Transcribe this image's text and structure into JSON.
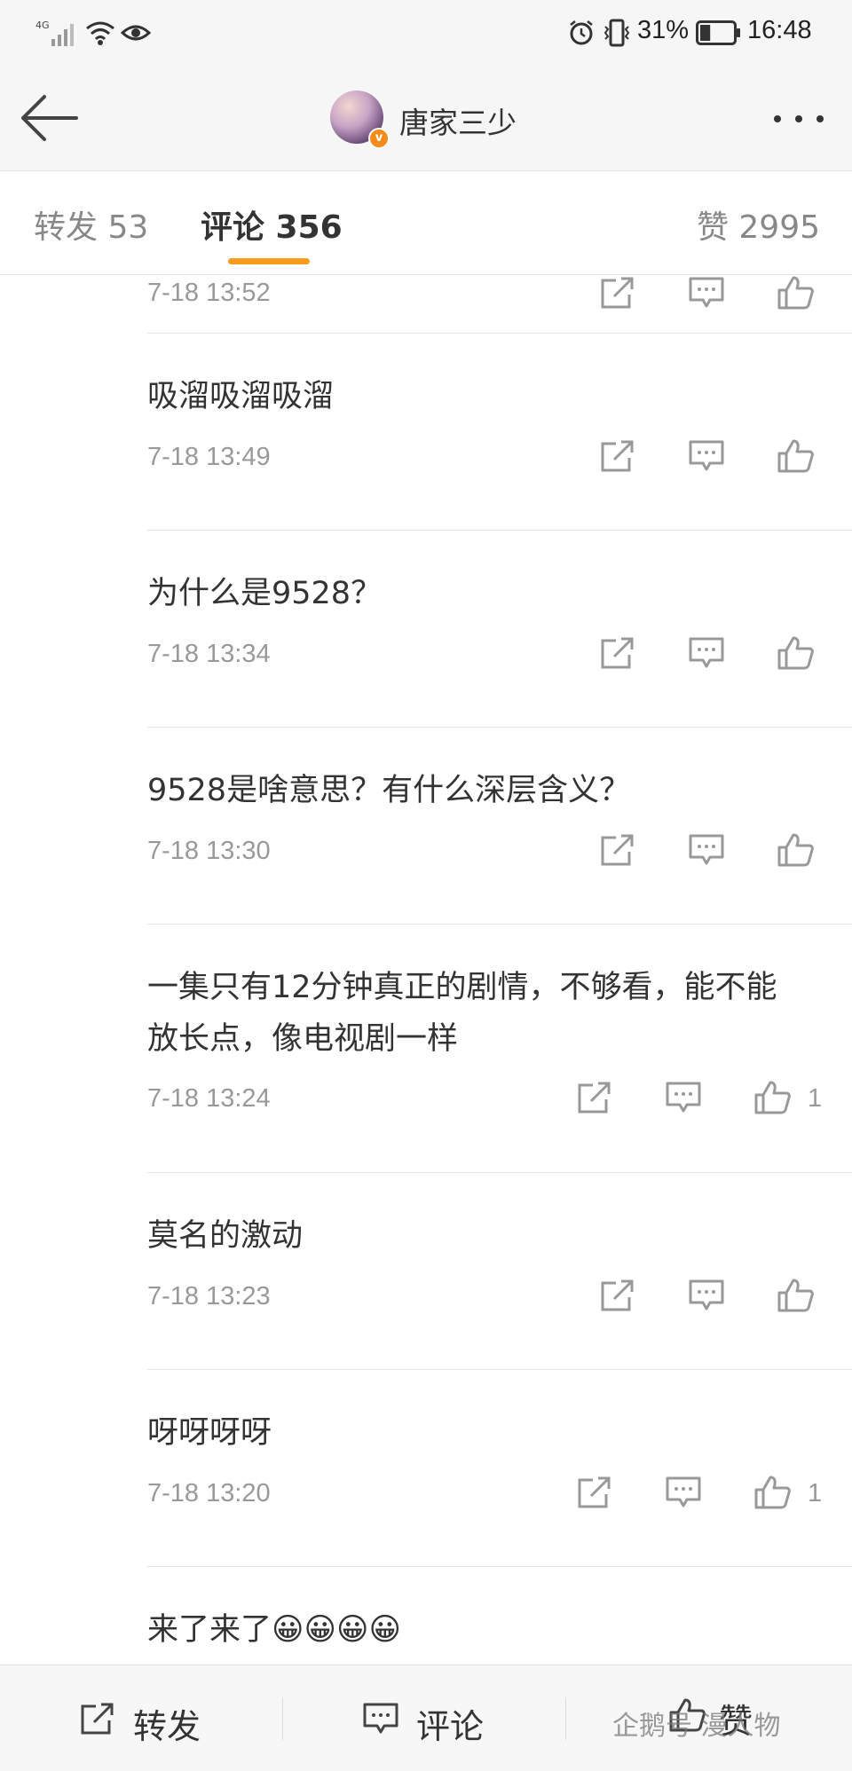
{
  "status_bar": {
    "network": "4G",
    "battery_percent": "31%",
    "battery_level": 0.31,
    "time": "16:48"
  },
  "header": {
    "account_name": "唐家三少",
    "verified_badge": "v",
    "back_icon": "arrow-left-icon",
    "more_icon": "more-dots-icon"
  },
  "tabs": {
    "reposts": "转发 53",
    "comments": "评论 356",
    "likes": "赞 2995",
    "active_color": "#f99b1c"
  },
  "comments": [
    {
      "text": "",
      "time": "7-18 13:52",
      "likes": ""
    },
    {
      "text": "吸溜吸溜吸溜",
      "time": "7-18 13:49",
      "likes": ""
    },
    {
      "text": "为什么是9528？",
      "time": "7-18 13:34",
      "likes": ""
    },
    {
      "text": "9528是啥意思？有什么深层含义？",
      "time": "7-18 13:30",
      "likes": ""
    },
    {
      "text": "一集只有12分钟真正的剧情，不够看，能不能放长点，像电视剧一样",
      "time": "7-18 13:24",
      "likes": "1"
    },
    {
      "text": "莫名的激动",
      "time": "7-18 13:23",
      "likes": ""
    },
    {
      "text": "呀呀呀呀",
      "time": "7-18 13:20",
      "likes": "1"
    },
    {
      "text": "来了来了😀😀😀😀",
      "time": "",
      "likes": ""
    }
  ],
  "bottom_bar": {
    "repost": "转发",
    "comment": "评论",
    "like": "赞"
  },
  "watermark": "企鹅号 漫人物"
}
